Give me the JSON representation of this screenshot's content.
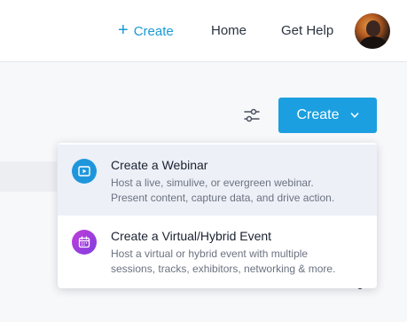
{
  "topnav": {
    "create_label": "Create",
    "create_icon": "plus-icon",
    "home_label": "Home",
    "help_label": "Get Help",
    "avatar_icon": "user-avatar"
  },
  "toolbar": {
    "filter_icon": "filter-sliders-icon",
    "create_button_label": "Create",
    "create_button_icon": "chevron-down-icon"
  },
  "create_menu": {
    "items": [
      {
        "title": "Create a Webinar",
        "description_line1": "Host a live, simulive, or evergreen webinar.",
        "description_line2": "Present content, capture data, and drive action.",
        "icon": "play-screen-icon",
        "highlighted": true
      },
      {
        "title": "Create a Virtual/Hybrid Event",
        "description_line1": "Host a virtual or hybrid event with multiple",
        "description_line2": "sessions, tracks, exhibitors, networking & more.",
        "icon": "calendar-icon",
        "highlighted": false
      }
    ]
  },
  "colors": {
    "accent": "#1b9fe0",
    "nav_create": "#1a9ad6",
    "webinar_icon_bg": "#1f96dc",
    "event_icon_bg_start": "#c23dd9",
    "event_icon_bg_end": "#7d3fe0",
    "highlight_bg": "#edf0f7"
  }
}
